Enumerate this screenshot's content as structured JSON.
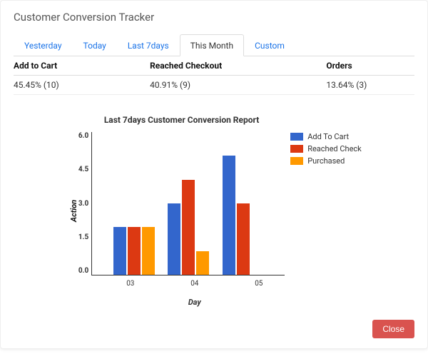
{
  "title": "Customer Conversion Tracker",
  "tabs": [
    {
      "label": "Yesterday",
      "active": false
    },
    {
      "label": "Today",
      "active": false
    },
    {
      "label": "Last 7days",
      "active": false
    },
    {
      "label": "This Month",
      "active": true
    },
    {
      "label": "Custom",
      "active": false
    }
  ],
  "stats": {
    "headers": [
      "Add to Cart",
      "Reached Checkout",
      "Orders"
    ],
    "values": [
      "45.45% (10)",
      "40.91% (9)",
      "13.64% (3)"
    ]
  },
  "close_label": "Close",
  "colors": {
    "add": "#3366cc",
    "reach": "#dc3912",
    "purch": "#ff9900"
  },
  "chart_data": {
    "type": "bar",
    "title": "Last 7days Customer Conversion Report",
    "xlabel": "Day",
    "ylabel": "Action",
    "categories": [
      "03",
      "04",
      "05"
    ],
    "series": [
      {
        "name": "Add To Cart",
        "values": [
          2,
          3,
          5
        ]
      },
      {
        "name": "Reached Checkout",
        "values": [
          2,
          4,
          3
        ]
      },
      {
        "name": "Purchased",
        "values": [
          2,
          1,
          0
        ]
      }
    ],
    "ylim": [
      0,
      6
    ],
    "yticks": [
      0.0,
      1.5,
      3.0,
      4.5,
      6.0
    ]
  }
}
